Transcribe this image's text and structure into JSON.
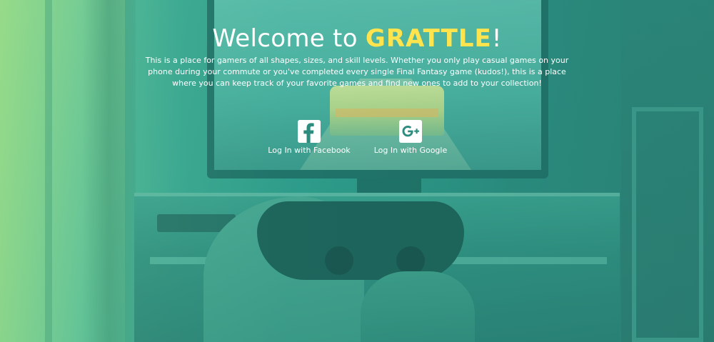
{
  "hero": {
    "heading_prefix": "Welcome to ",
    "brand_name": "GRATTLE",
    "heading_suffix": "!",
    "intro": "This is a place for gamers of all shapes, sizes, and skill levels. Whether you only play casual games on your phone during your commute or you've completed every single Final Fantasy game (kudos!), this is a place where you can keep track of your favorite games and find new ones to add to your collection!"
  },
  "login": {
    "facebook": {
      "label": "Log In with Facebook",
      "icon": "facebook-icon"
    },
    "google": {
      "label": "Log In with Google",
      "icon": "google-plus-icon"
    }
  },
  "colors": {
    "brand": "#ffe44d",
    "text": "#ffffff",
    "overlay_teal": "#2e9c8a",
    "overlay_green": "#9fdc8a"
  }
}
